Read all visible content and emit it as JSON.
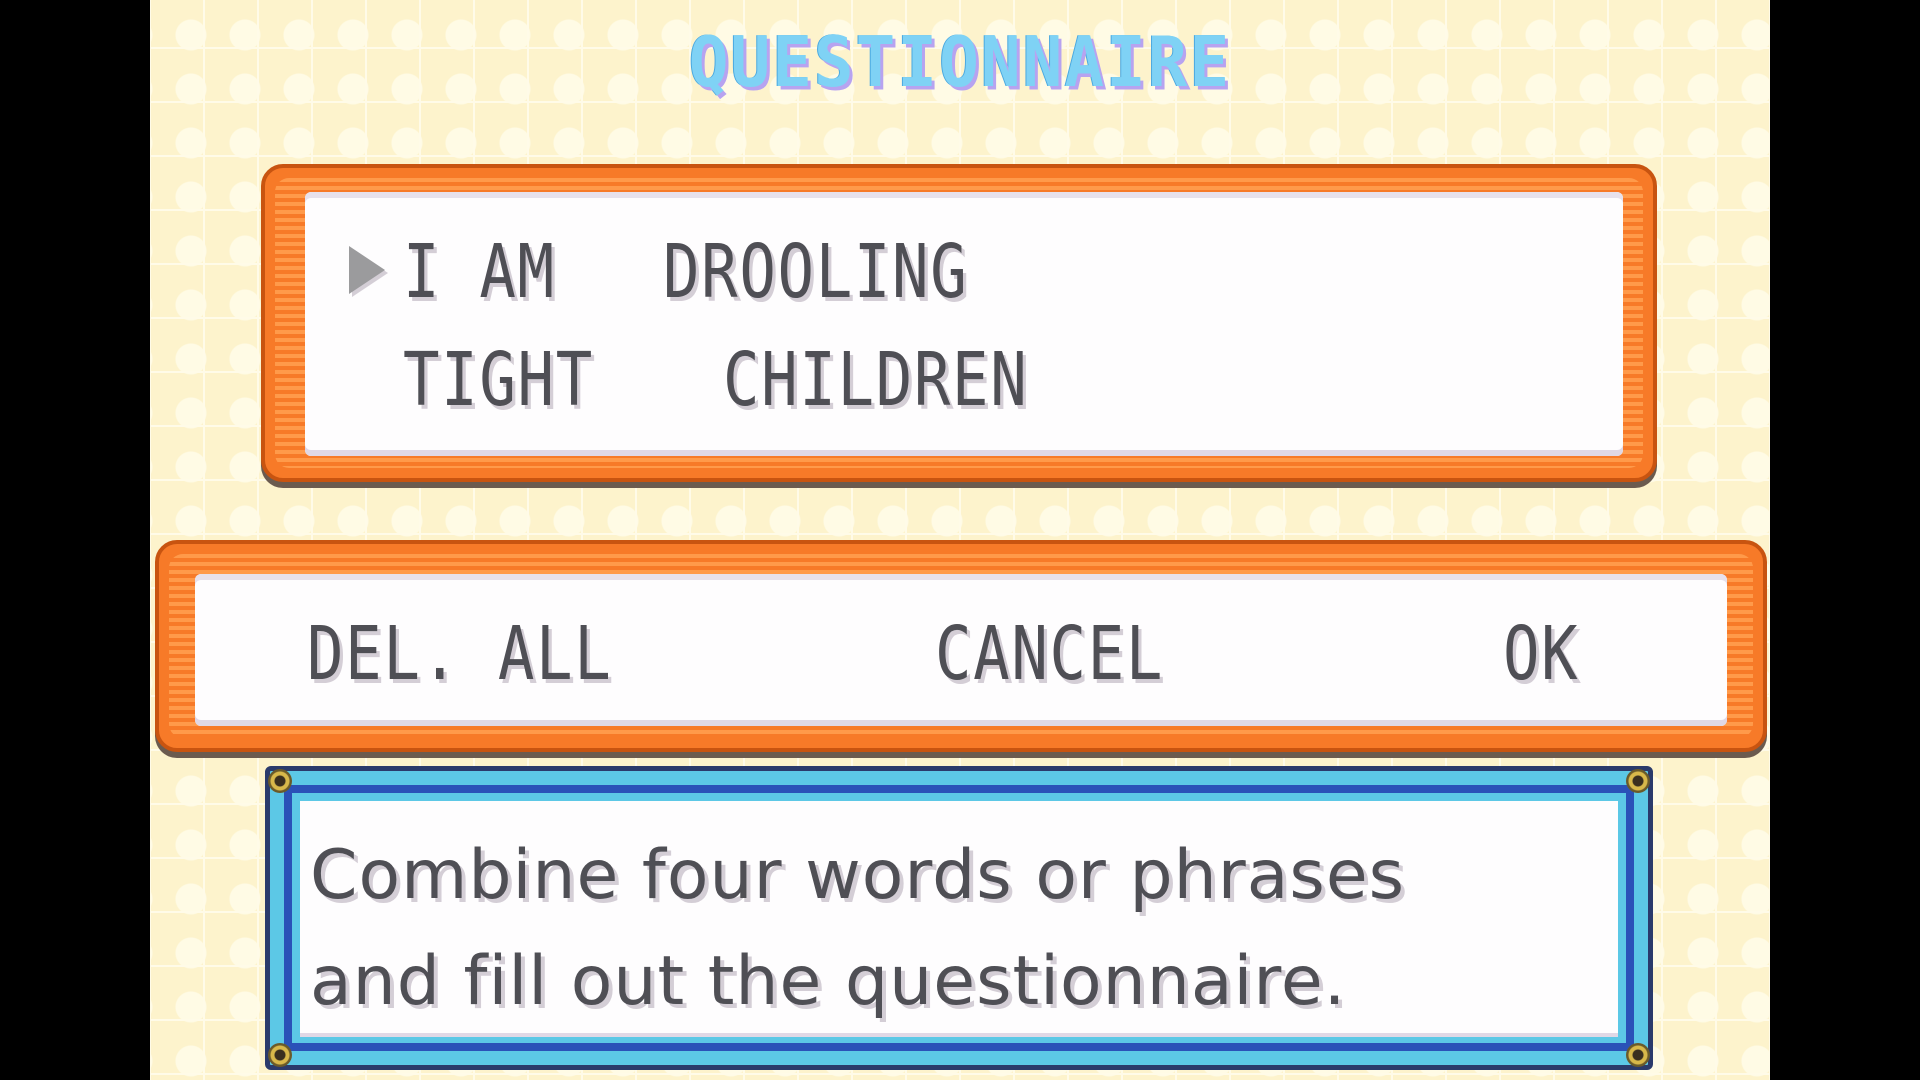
{
  "screen": {
    "title": "QUESTIONNAIRE"
  },
  "phrase": {
    "words": [
      "I AM",
      "DROOLING",
      "TIGHT",
      "CHILDREN"
    ],
    "cursor_icon": "triangle-right-cursor"
  },
  "menu": {
    "del_all": "DEL. ALL",
    "cancel": "CANCEL",
    "ok": "OK"
  },
  "message": {
    "line1": "Combine four words or phrases",
    "line2": "and fill out the questionnaire."
  },
  "colors": {
    "title": "#7fd2f5",
    "orange_frame": "#f77a28",
    "blue_frame": "#5cc8e6",
    "text": "#4f4f55",
    "background": "#fdf3cc"
  }
}
